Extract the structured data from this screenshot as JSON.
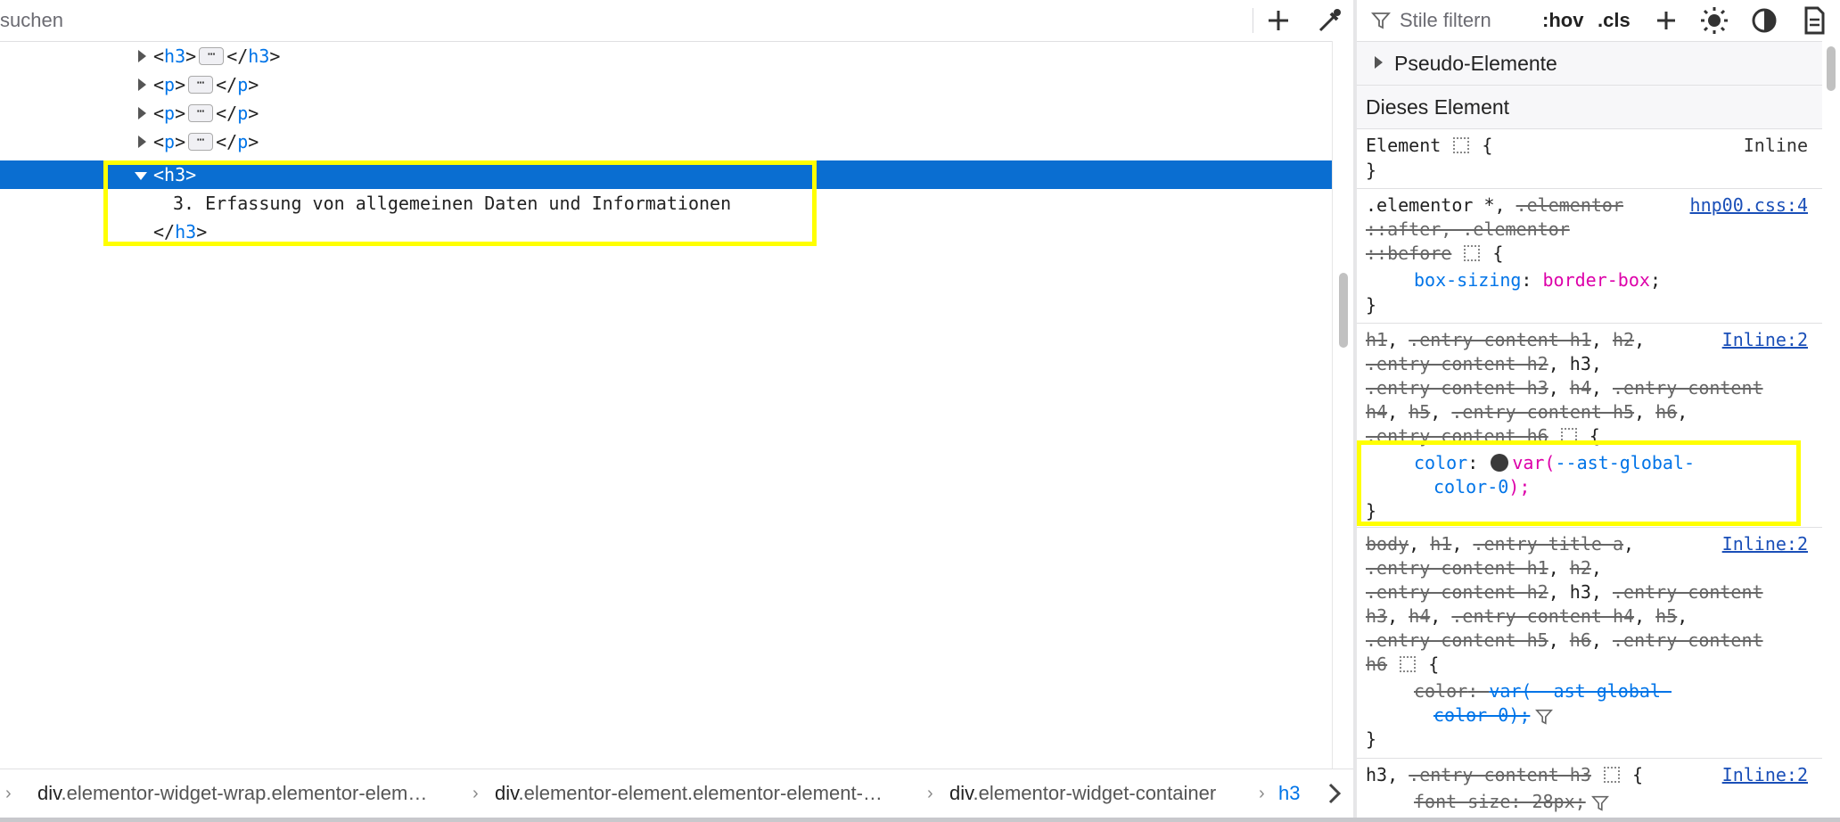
{
  "toolbar": {
    "search_placeholder": "HTML durchsuchen",
    "search_visible": "suchen",
    "add_node_icon": "plus-icon",
    "picker_icon": "eyedropper-icon"
  },
  "markup": {
    "rows": [
      {
        "open": "h3",
        "close": "h3",
        "collapsed": true
      },
      {
        "open": "p",
        "close": "p",
        "collapsed": true
      },
      {
        "open": "p",
        "close": "p",
        "collapsed": true
      },
      {
        "open": "p",
        "close": "p",
        "collapsed": true
      }
    ],
    "selected_tag": "h3",
    "selected_text": "3. Erfassung von allgemeinen Daten und Informationen",
    "selected_close": "h3",
    "ellipsis": "⋯"
  },
  "breadcrumbs": {
    "items": [
      {
        "el": "div",
        "cls": ".elementor-widget-wrap.elementor-elem…"
      },
      {
        "el": "div",
        "cls": ".elementor-element.elementor-element-…"
      },
      {
        "el": "div",
        "cls": ".elementor-widget-container"
      }
    ],
    "current": "h3",
    "separator": "›"
  },
  "rules_toolbar": {
    "filter_placeholder": "Stile filtern",
    "hov": ":hov",
    "cls": ".cls"
  },
  "rules": {
    "pseudo_elements_label": "Pseudo-Elemente",
    "this_element_label": "Dieses Element",
    "element_rule": {
      "selector": "Element",
      "source": "Inline"
    },
    "rule_elementor": {
      "line1_a": ".elementor *,",
      "line1_b": ".elementor",
      "line2": "::after, .elementor",
      "line3": "::before",
      "source": "hnp00.css:4",
      "prop": "box-sizing",
      "value": "border-box"
    },
    "rule_headings": {
      "lines": [
        [
          "h1",
          ", ",
          ".entry-content h1",
          ", ",
          "h2",
          ","
        ],
        [
          ".entry-content h2",
          ", ",
          "h3",
          ","
        ],
        [
          ".entry-content h3",
          ", ",
          "h4",
          ", ",
          ".entry-content"
        ],
        [
          "h4",
          ", ",
          "h5",
          ", ",
          ".entry-content h5",
          ", ",
          "h6",
          ","
        ],
        [
          ".entry-content h6"
        ]
      ],
      "source": "Inline:2",
      "prop": "color",
      "value_fn": "var(",
      "value_var": "--ast-global-",
      "value_var2": "color-0",
      "value_end": ");"
    },
    "rule_body": {
      "lines": [
        [
          "body",
          ", ",
          "h1",
          ", ",
          ".entry-title a",
          ","
        ],
        [
          ".entry-content h1",
          ", ",
          "h2",
          ","
        ],
        [
          ".entry-content h2",
          ", ",
          "h3",
          ", ",
          ".entry-content"
        ],
        [
          "h3",
          ", ",
          "h4",
          ", ",
          ".entry-content h4",
          ", ",
          "h5",
          ","
        ],
        [
          ".entry-content h5",
          ", ",
          "h6",
          ", ",
          ".entry-content"
        ],
        [
          "h6"
        ]
      ],
      "source": "Inline:2",
      "prop": "color",
      "value_var": "var(--ast-global-",
      "value_var2": "color-0);"
    },
    "rule_h3": {
      "selector_a": "h3",
      "selector_b": ".entry-content h3",
      "source": "Inline:2",
      "prop": "font-size",
      "value": "28px;"
    },
    "open_brace": "{",
    "close_brace": "}"
  },
  "colors": {
    "selection": "#0a6ed1",
    "highlight_box": "#ffff00",
    "tag_blue": "#0074e8",
    "value_magenta": "#dd00a9"
  }
}
